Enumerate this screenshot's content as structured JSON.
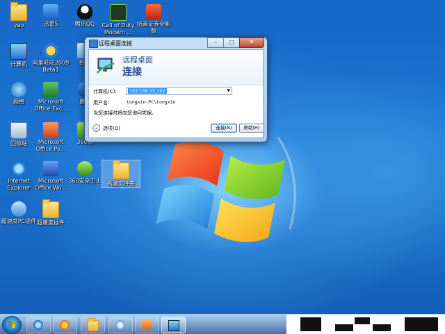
{
  "desktop": {
    "icons": [
      {
        "label": "yao",
        "x": 0,
        "y": 0
      },
      {
        "label": "迅雷5"
      },
      {
        "label": "腾讯QQ"
      },
      {
        "label": "Call of Duty Modern ..."
      },
      {
        "label": "招商证券全能版"
      },
      {
        "label": "计算机"
      },
      {
        "label": "阿里旺旺2009 Beta1"
      },
      {
        "label": "控制"
      },
      {
        "label": "网络"
      },
      {
        "label": "Microsoft Office Exc..."
      },
      {
        "label": "暴风"
      },
      {
        "label": "回收站"
      },
      {
        "label": "Microsoft Office Po..."
      },
      {
        "label": "360软"
      },
      {
        "label": "Internet Explorer"
      },
      {
        "label": "Microsoft Office Wo..."
      },
      {
        "label": "360安全卫士"
      },
      {
        "label": "新建文件夹"
      },
      {
        "label": "超速度PC插件"
      },
      {
        "label": "超速度插件"
      }
    ]
  },
  "dialog": {
    "title": "远程桌面连接",
    "header_line1": "远程桌面",
    "header_line2": "连接",
    "computer_label": "计算机(C):",
    "computer_value": "192.168.15.102",
    "user_label": "用户名:",
    "user_value": "tongxin-PC\\tongxin",
    "note": "当您连接时将向您询问凭据。",
    "options_label": "选项(O)",
    "connect_button": "连接(N)",
    "help_button": "帮助(H)",
    "minimize": "–",
    "maximize": "□",
    "close": "✕"
  },
  "taskbar": {
    "items": [
      "internet-explorer",
      "media-player",
      "file-explorer",
      "media-center",
      "camera-app",
      "remote-desktop"
    ]
  },
  "colors": {
    "accent": "#1a73cf",
    "selection": "#3399ff"
  }
}
